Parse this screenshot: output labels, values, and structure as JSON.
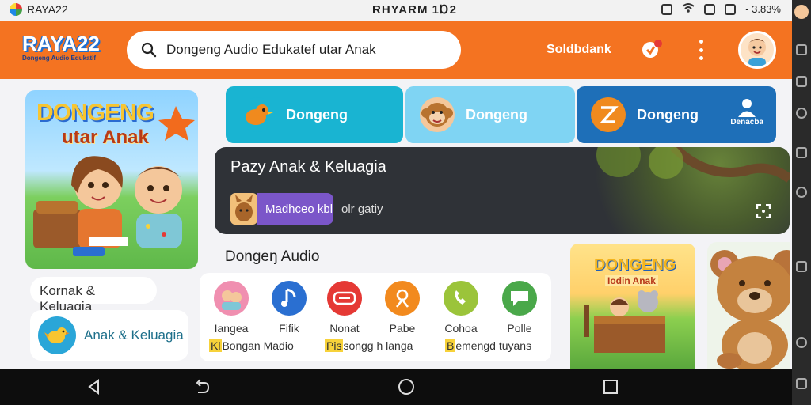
{
  "status_bar": {
    "app_name": "RAYA22",
    "center_text": "RHYARM 1Ɒ2",
    "battery": "- 3.83%"
  },
  "header": {
    "brand_title": "RAYA22",
    "brand_subtitle": "Dongeng Audio Edukatif",
    "search_value": "Dongeng Audio Edukatef utar Anak",
    "link_label": "Soldbdank"
  },
  "featured_book": {
    "title_line1": "DONGENG",
    "title_line2": "utar Anak"
  },
  "sidebar": {
    "label": "Kornak & Keluagia",
    "item_label": "Anak & Keluagia"
  },
  "categories": [
    {
      "label": "Dongeng",
      "color": "#19b4d2"
    },
    {
      "label": "Dongeng",
      "color": "#7fd4f3"
    },
    {
      "label": "Dongeng",
      "color": "#1e6fb8",
      "extra_label": "Denacba"
    }
  ],
  "player": {
    "title": "Pazy Anak & Keluagia",
    "chip_label": "Madhceo kbl",
    "subtitle": "olr gatiy"
  },
  "section": {
    "title": "Dongeŋ Audio"
  },
  "apps": [
    {
      "name": "Iangea",
      "color": "#f08fb0"
    },
    {
      "name": "Fifik",
      "color": "#2a6fd1"
    },
    {
      "name": "Nonat",
      "color": "#e53935"
    },
    {
      "name": "Pabe",
      "color": "#f28a1e"
    },
    {
      "name": "Cohoa",
      "color": "#9bc43a"
    },
    {
      "name": "Polle",
      "color": "#4aa84a"
    }
  ],
  "apps_subs": [
    {
      "hl": "Kl",
      "text": "Bongan Madio"
    },
    {
      "hl": "Pis",
      "text": "songg h langa"
    },
    {
      "hl": "B",
      "text": "emengd tuyans"
    }
  ],
  "right_cards": {
    "title1": "DONGENG",
    "title2": "Iodin Anak"
  }
}
